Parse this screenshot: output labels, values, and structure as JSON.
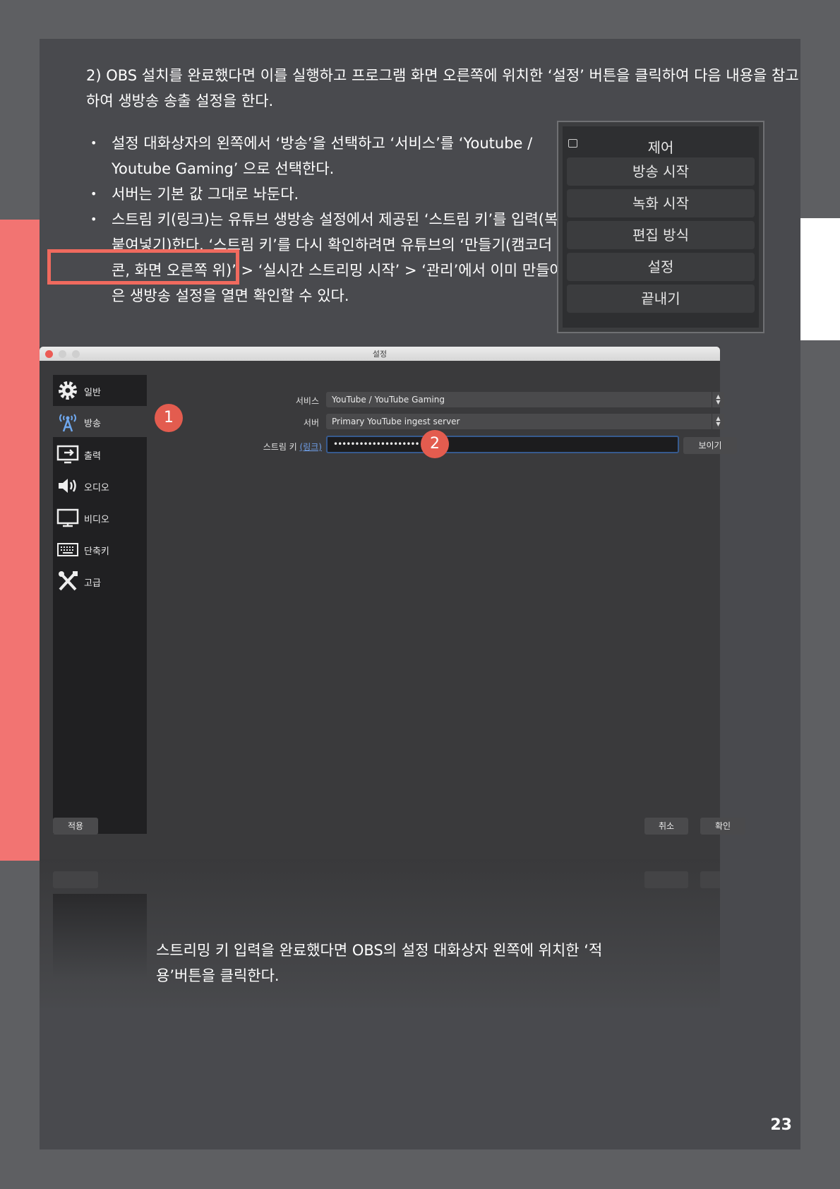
{
  "intro": "2) OBS 설치를 완료했다면 이를 실행하고 프로그램 화면 오른쪽에 위치한 ‘설정’ 버튼을 클릭하여 다음 내용을 참고하여 생방송 송출 설정을 한다.",
  "bullets": [
    "설정 대화상자의 왼쪽에서 ‘방송’을 선택하고 ‘서비스’를 ‘Youtube / Youtube Gaming’ 으로 선택한다.",
    "서버는 기본 값 그대로 놔둔다.",
    "스트림 키(링크)는 유튜브 생방송 설정에서 제공된 ‘스트림 키’를 입력(복사/붙여넣기)한다. ‘스트림 키’를 다시 확인하려면 유튜브의 ‘만들기(캠코더 아이콘, 화면 오른쪽 위)’ > ‘실시간 스트리밍 시작’ > ‘관리’에서 이미 만들어 놓은 생방송 설정을 열면 확인할 수 있다."
  ],
  "dock": {
    "title": "제어",
    "buttons": [
      "방송 시작",
      "녹화 시작",
      "편집 방식",
      "설정",
      "끝내기"
    ]
  },
  "settings_window": {
    "title": "설정",
    "sidebar": [
      "일반",
      "방송",
      "출력",
      "오디오",
      "비디오",
      "단축키",
      "고급"
    ],
    "service_label": "서비스",
    "service_value": "YouTube / YouTube Gaming",
    "server_label": "서버",
    "server_value": "Primary YouTube ingest server",
    "stream_key_label": "스트림 키",
    "stream_key_link": "(링크)",
    "stream_key_value": "••••••••••••••••••••",
    "show_button": "보이기",
    "apply_button": "적용",
    "cancel_button": "취소",
    "ok_button": "확인",
    "badges": [
      "1",
      "2"
    ]
  },
  "caption": "스트리밍 키 입력을 완료했다면 OBS의 설정 대화상자 왼쪽에 위치한 ‘적용’버튼을 클릭한다.",
  "page_number": "23",
  "colors": {
    "accent": "#f27472",
    "highlight": "#f06a5e",
    "badge": "#e35c4f",
    "link": "#6f9fe8"
  }
}
